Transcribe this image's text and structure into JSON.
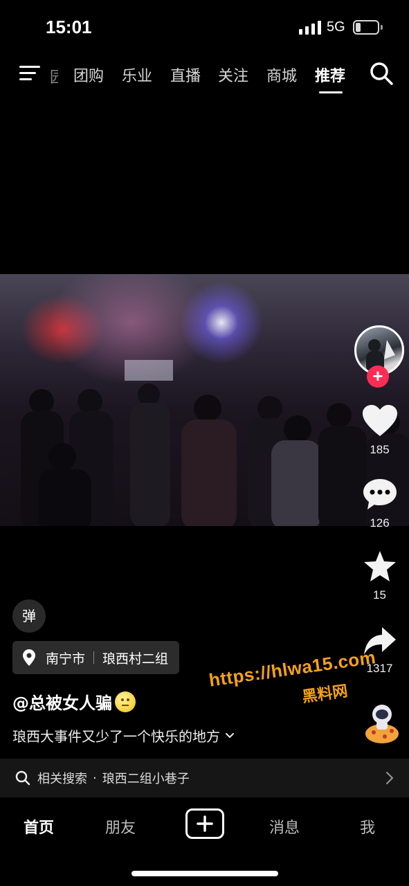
{
  "status_bar": {
    "time": "15:01",
    "network": "5G"
  },
  "top_nav": {
    "cut_tab": "园",
    "tabs": [
      "团购",
      "乐业",
      "直播",
      "关注",
      "商城",
      "推荐"
    ],
    "active_tab": "推荐"
  },
  "side_rail": {
    "like_count": "185",
    "comment_count": "126",
    "favorite_count": "15",
    "share_count": "1317"
  },
  "post": {
    "danmu_label": "弹",
    "location_city": "南宁市",
    "location_place": "琅西村二组",
    "author": "@总被女人骗",
    "caption": "琅西大事件又少了一个快乐的地方"
  },
  "watermark": {
    "url": "https://hlwa15.com",
    "name": "黑料网"
  },
  "related_search": {
    "label": "相关搜索",
    "dot": "·",
    "query": "琅西二组小巷子"
  },
  "bottom_nav": {
    "home": "首页",
    "friends": "朋友",
    "messages": "消息",
    "me": "我"
  },
  "icons": [
    "menu-icon",
    "search-icon",
    "heart-icon",
    "comment-icon",
    "star-icon",
    "share-icon",
    "location-pin-icon",
    "chevron-down-icon",
    "chevron-right-icon",
    "plus-icon"
  ],
  "colors": {
    "accent": "#fe2c55",
    "watermark": "#f6a214",
    "background": "#000000"
  }
}
